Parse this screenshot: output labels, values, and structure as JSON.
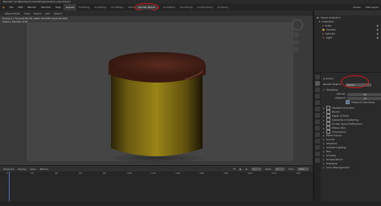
{
  "titlebar": {
    "title": "Blender* [C:\\Blender\\Content\\Projects\\stool_tops.blend]"
  },
  "menus": [
    "File",
    "Edit",
    "Render",
    "Window",
    "Help"
  ],
  "workspaces": [
    "Layout",
    "Modeling",
    "Sculpting",
    "UV Editing",
    "Texture Paint",
    "Shading",
    "Animation",
    "Rendering",
    "Compositing",
    "Scripting"
  ],
  "active_workspace_index": 0,
  "header_right": {
    "scene": "Scene",
    "view_layer": "View Layer"
  },
  "render_button_label": "Render Result",
  "viewport": {
    "header_buttons": [
      "Object Mode",
      "View",
      "Select",
      "Add",
      "Object"
    ],
    "overlay_line1": "Frame:1 | Time:00:00.00 | Mem:26.52M, Peak:26.52M",
    "overlay_line2": "Scene | Sample 1/16"
  },
  "outliner": {
    "title": "Scene Collection",
    "items": [
      {
        "label": "Collection",
        "icon": "collection-icon"
      },
      {
        "label": "Cube",
        "icon": "mesh-icon"
      },
      {
        "label": "Camera",
        "icon": "camera-icon"
      },
      {
        "label": "Cylinder",
        "icon": "mesh-icon"
      },
      {
        "label": "Light",
        "icon": "light-icon"
      }
    ]
  },
  "properties": {
    "context_label": "Scene",
    "render_engine_label": "Render Engine",
    "render_engine_value": "Eevee",
    "sampling_label": "Sampling",
    "render_label": "Render",
    "render_value": "64",
    "viewport_label": "Viewport",
    "viewport_value": "16",
    "denoising_label": "Viewport Denoising",
    "panels": [
      "Ambient Occlusion",
      "Bloom",
      "Depth of Field",
      "Subsurface Scattering",
      "Screen Space Reflections",
      "Motion Blur",
      "Volumetrics",
      "Performance",
      "Curves",
      "Shadows",
      "Indirect Lighting",
      "Film",
      "Simplify",
      "Grease Pencil",
      "Freestyle",
      "Color Management"
    ]
  },
  "timeline": {
    "menus": [
      "Playback",
      "Keying",
      "View",
      "Marker"
    ],
    "start_label": "Start",
    "start_value": "1",
    "end_label": "End",
    "end_value": "250",
    "current_frame": "1",
    "ticks": [
      "0",
      "20",
      "40",
      "60",
      "80",
      "100",
      "120",
      "140",
      "160",
      "180",
      "200",
      "220",
      "240"
    ]
  },
  "colors": {
    "accent": "#4772b3",
    "annotation": "#d81818",
    "cylinder_side": "#8a7414",
    "cylinder_top": "#5e2a1c"
  }
}
